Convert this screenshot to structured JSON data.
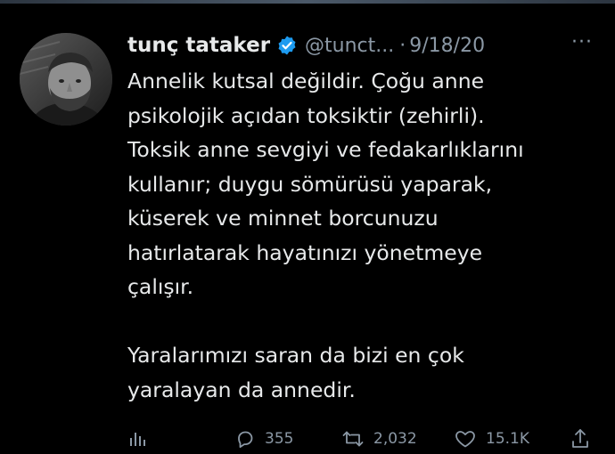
{
  "tweet": {
    "author_name": "tunç tataker",
    "handle": "@tunct...",
    "separator": "·",
    "date": "9/18/20",
    "more_label": "···",
    "lines_p1": [
      "Annelik kutsal değildir. Çoğu anne",
      "psikolojik açıdan toksiktir (zehirli).",
      "Toksik anne sevgiyi ve fedakarlıklarını",
      "kullanır; duygu sömürüsü yaparak,",
      "küserek ve minnet borcunuzu",
      "hatırlatarak hayatınızı yönetmeye",
      "çalışır."
    ],
    "lines_p2": [
      "Yaralarımızı saran da bizi en çok",
      "yaralayan da annedir."
    ]
  },
  "actions": {
    "analytics_icon": "analytics-icon",
    "reply_icon": "reply-icon",
    "reply_count": "355",
    "retweet_icon": "retweet-icon",
    "retweet_count": "2,032",
    "like_icon": "heart-icon",
    "like_count": "15.1K",
    "share_icon": "share-icon"
  },
  "colors": {
    "background": "#000000",
    "primary_text": "#e7e9ea",
    "secondary_text": "#8b98a5",
    "verified_badge": "#1d9bf0"
  }
}
